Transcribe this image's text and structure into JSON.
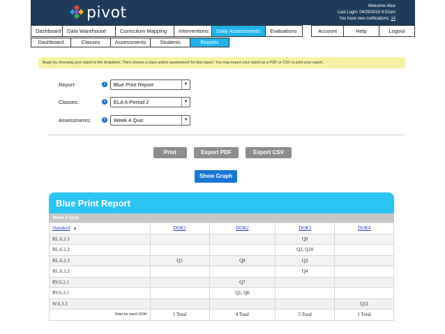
{
  "brand": {
    "name": "pivot"
  },
  "user": {
    "welcome": "Welcome Alice",
    "last_login": "Last Login: 04/29/2015 9:52am",
    "notifications_prefix": "You have new notifications:",
    "notifications_count": "14"
  },
  "nav": {
    "main_tabs": [
      {
        "label": "Dashboard"
      },
      {
        "label": "Data Warehouse"
      },
      {
        "label": "Curriculum Mapping"
      },
      {
        "label": "Interventions"
      },
      {
        "label": "Daily Assessments",
        "active": true
      },
      {
        "label": "Evaluations"
      }
    ],
    "right_tabs": [
      {
        "label": "Account"
      },
      {
        "label": "Help"
      },
      {
        "label": "Logout"
      }
    ],
    "sub_tabs": [
      {
        "label": "Dashboard"
      },
      {
        "label": "Classes"
      },
      {
        "label": "Assessments"
      },
      {
        "label": "Students"
      },
      {
        "label": "Reports",
        "active": true
      }
    ]
  },
  "instructions": "Begin by choosing your report in the dropdown. Then choose a class and/or assessment for that report. You may export your report as a PDF or CSV or print your report.",
  "form": {
    "report_label": "Report:",
    "report_value": "Blue Print Report",
    "classes_label": "Classes:",
    "classes_value": "ELA 6-Period 2",
    "assessments_label": "Assessments:",
    "assessments_value": "Week 4 Quiz",
    "info_glyph": "i"
  },
  "buttons": {
    "print": "Print",
    "export_pdf": "Export PDF",
    "export_csv": "Export CSV",
    "show_graph": "Show Graph"
  },
  "colors": {
    "header_bg": "#1f3b5c",
    "accent": "#20b3ea",
    "banner": "#f7f3a4",
    "primary_button": "#1976d2",
    "secondary_button": "#8d8d8d"
  },
  "report": {
    "title": "Blue Print Report",
    "quiz_name": "Week 4 Quiz",
    "columns": [
      "Standard",
      "DOK1",
      "DOK2",
      "DOK3",
      "DOK4"
    ],
    "sort_glyph": "▲",
    "rows": [
      [
        "RL.6.2.1",
        "",
        "",
        "Q9",
        ""
      ],
      [
        "RL.6.2.2",
        "",
        "",
        "Q2, Q10",
        ""
      ],
      [
        "RL.6.2.3",
        "Q5",
        "Q8",
        "Q3",
        ""
      ],
      [
        "RL.6.3.2",
        "",
        "",
        "Q4",
        ""
      ],
      [
        "RV.6.2.1",
        "",
        "Q7",
        "",
        ""
      ],
      [
        "RV.6.3.1",
        "",
        "Q1, Q6",
        "",
        ""
      ],
      [
        "W.6.3.3",
        "",
        "",
        "",
        "Q11"
      ]
    ],
    "totals_label": "Total for each DOK",
    "totals": [
      "1 Total",
      "4 Total",
      "5 Total",
      "1 Total"
    ]
  }
}
